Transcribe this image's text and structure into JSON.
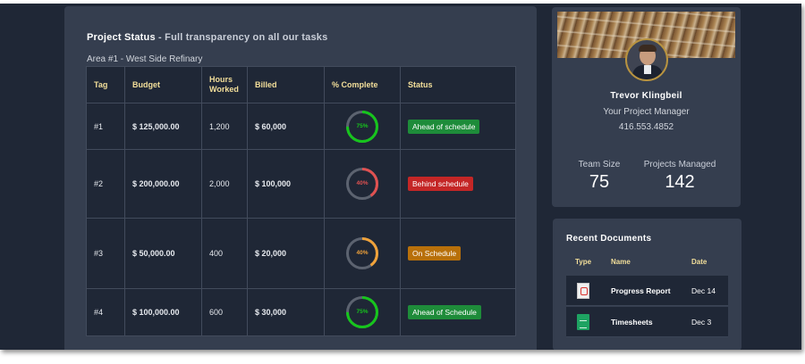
{
  "project": {
    "title": "Project Status",
    "separator": "-",
    "subtitle": "Full transparency on all our tasks",
    "area": "Area #1 - West Side Refinary",
    "columns": [
      "Tag",
      "Budget",
      "Hours Worked",
      "Billed",
      "% Complete",
      "Status"
    ],
    "rows": [
      {
        "tag": "#1",
        "budget": "$ 125,000.00",
        "hours": "1,200",
        "billed": "$ 60,000",
        "complete": "75%",
        "percent": 75,
        "ring_color": "#16c51c",
        "text_color": "#16c51c",
        "status": "Ahead of schedule",
        "status_color": "#1e8c3a"
      },
      {
        "tag": "#2",
        "budget": "$ 200,000.00",
        "hours": "2,000",
        "billed": "$ 100,000",
        "complete": "40%",
        "percent": 40,
        "ring_color": "#e05151",
        "text_color": "#e05151",
        "status": "Behind schedule",
        "status_color": "#c42626"
      },
      {
        "tag": "#3",
        "budget": "$ 50,000.00",
        "hours": "400",
        "billed": "$ 20,000",
        "complete": "40%",
        "percent": 40,
        "ring_color": "#f0a23a",
        "text_color": "#f0a23a",
        "status": "On Schedule",
        "status_color": "#b8700a"
      },
      {
        "tag": "#4",
        "budget": "$ 100,000.00",
        "hours": "600",
        "billed": "$ 30,000",
        "complete": "75%",
        "percent": 75,
        "ring_color": "#16c51c",
        "text_color": "#16c51c",
        "status": "Ahead of Schedule",
        "status_color": "#1e8c3a"
      }
    ]
  },
  "profile": {
    "name": "Trevor Klingbeil",
    "role": "Your Project Manager",
    "phone": "416.553.4852",
    "team_size_label": "Team Size",
    "team_size": "75",
    "projects_label": "Projects Managed",
    "projects": "142"
  },
  "documents": {
    "title": "Recent Documents",
    "headers": {
      "type": "Type",
      "name": "Name",
      "date": "Date"
    },
    "items": [
      {
        "icon": "pdf-file-icon",
        "name": "Progress Report",
        "date": "Dec 14"
      },
      {
        "icon": "spreadsheet-file-icon",
        "name": "Timesheets",
        "date": "Dec 3"
      }
    ]
  }
}
